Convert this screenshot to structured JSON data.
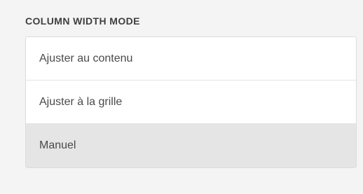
{
  "column_width": {
    "heading": "COLUMN WIDTH MODE",
    "options": [
      {
        "label": "Ajuster au contenu",
        "selected": false
      },
      {
        "label": "Ajuster à la grille",
        "selected": false
      },
      {
        "label": "Manuel",
        "selected": true
      }
    ]
  }
}
